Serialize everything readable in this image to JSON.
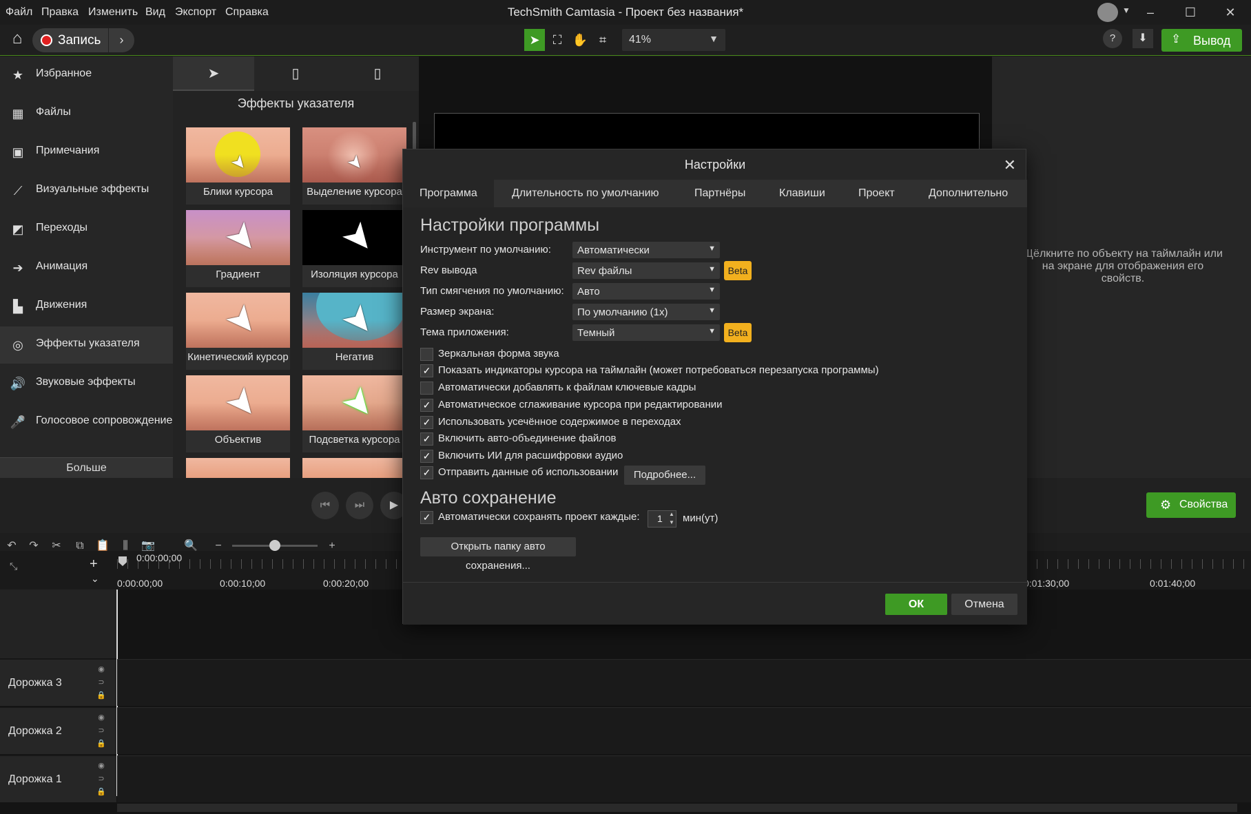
{
  "app": {
    "title": "TechSmith Camtasia - Проект без названия*"
  },
  "menu": [
    "Файл",
    "Правка",
    "Изменить",
    "Вид",
    "Экспорт",
    "Справка"
  ],
  "toolbar": {
    "record_label": "Запись",
    "zoom": "41%",
    "export_label": "Вывод",
    "help": "?"
  },
  "sidebar": {
    "items": [
      {
        "label": "Избранное",
        "icon": "star-icon"
      },
      {
        "label": "Файлы",
        "icon": "film-icon"
      },
      {
        "label": "Примечания",
        "icon": "annotation-icon"
      },
      {
        "label": "Визуальные эффекты",
        "icon": "magic-wand-icon"
      },
      {
        "label": "Переходы",
        "icon": "transition-icon"
      },
      {
        "label": "Анимация",
        "icon": "animation-icon"
      },
      {
        "label": "Движения",
        "icon": "behaviors-icon"
      },
      {
        "label": "Эффекты указателя",
        "icon": "cursor-effects-icon"
      },
      {
        "label": "Звуковые эффекты",
        "icon": "speaker-icon"
      },
      {
        "label": "Голосовое сопровождение",
        "icon": "microphone-icon"
      }
    ],
    "active_index": 7,
    "more_label": "Больше"
  },
  "effects": {
    "title": "Эффекты указателя",
    "tiles": [
      "Блики курсора",
      "Выделение курсора",
      "Градиент",
      "Изоляция курсора",
      "Кинетический курсор",
      "Негатив",
      "Объектив",
      "Подсветка курсора"
    ]
  },
  "properties": {
    "hint": "Щёлкните по объекту на таймлайн или на экране для отображения его свойств.",
    "button_label": "Свойства"
  },
  "timeline": {
    "playhead_time": "0:00:00;00",
    "ruler_labels": [
      "0:00:00;00",
      "0:00:10;00",
      "0:00:20;00",
      "0:01:30;00",
      "0:01:40;00"
    ],
    "tracks": [
      "Дорожка 3",
      "Дорожка 2",
      "Дорожка 1"
    ]
  },
  "dialog": {
    "title": "Настройки",
    "tabs": [
      "Программа",
      "Длительность по умолчанию",
      "Партнёры",
      "Клавиши",
      "Проект",
      "Дополнительно"
    ],
    "active_tab": 0,
    "section_program": "Настройки программы",
    "fields": [
      {
        "label": "Инструмент по умолчанию:",
        "value": "Автоматически",
        "beta": false
      },
      {
        "label": "Rev вывода",
        "value": "Rev файлы",
        "beta": true
      },
      {
        "label": "Тип смягчения по умолчанию:",
        "value": "Авто",
        "beta": false
      },
      {
        "label": "Размер экрана:",
        "value": "По умолчанию (1x)",
        "beta": false
      },
      {
        "label": "Тема приложения:",
        "value": "Темный",
        "beta": true
      }
    ],
    "beta_label": "Beta",
    "checkboxes": [
      {
        "label": "Зеркальная форма звука",
        "checked": false
      },
      {
        "label": "Показать индикаторы курсора на таймлайн (может потребоваться перезапуска программы)",
        "checked": true
      },
      {
        "label": "Автоматически добавлять к файлам ключевые кадры",
        "checked": false
      },
      {
        "label": "Автоматическое сглаживание курсора при редактировании",
        "checked": true
      },
      {
        "label": "Использовать усечённое содержимое в переходах",
        "checked": true
      },
      {
        "label": "Включить авто-объединение файлов",
        "checked": true
      },
      {
        "label": "Включить ИИ для расшифровки аудио",
        "checked": true
      },
      {
        "label": "Отправить данные об использовании",
        "checked": true
      }
    ],
    "more_info_label": "Подробнее...",
    "section_autosave": "Авто сохранение",
    "autosave": {
      "label": "Автоматически сохранять проект каждые:",
      "checked": true,
      "value": "1",
      "unit": "мин(ут)"
    },
    "open_folder_label": "Открыть папку авто сохранения...",
    "ok_label": "ОК",
    "cancel_label": "Отмена"
  },
  "colors": {
    "accent": "#3e9a24",
    "beta": "#f2b01e",
    "background": "#1a1a1a"
  }
}
